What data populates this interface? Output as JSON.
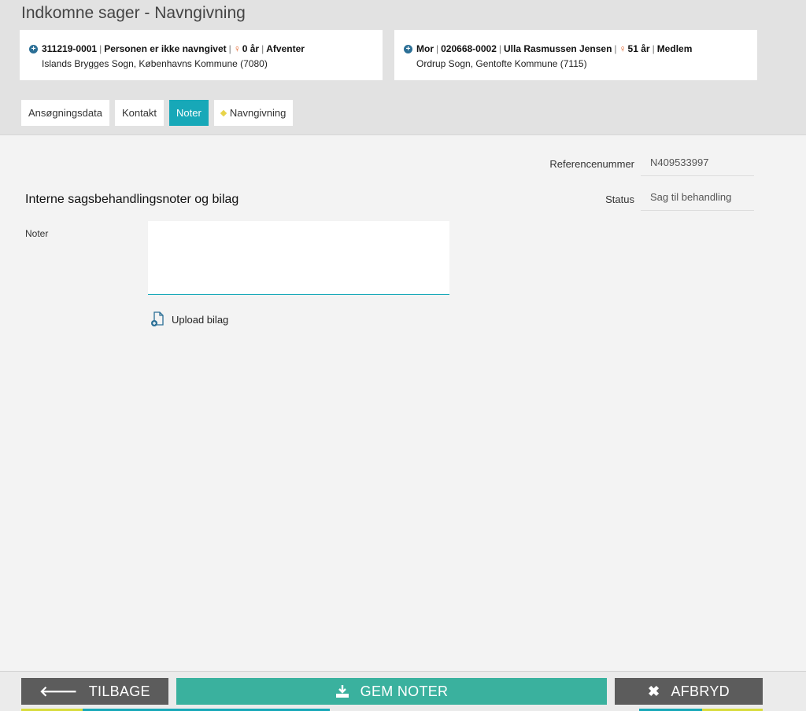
{
  "page": {
    "title": "Indkomne sager - Navngivning"
  },
  "cards": [
    {
      "cpr_prefix": "311219-",
      "cpr_suffix": "0001",
      "name": "Personen er ikke navngivet",
      "age": "0 år",
      "status": "Afventer",
      "address": "Islands Brygges Sogn, Københavns Kommune (7080)"
    },
    {
      "role": "Mor",
      "cpr_prefix": "020668-",
      "cpr_suffix": "0002",
      "name": "Ulla Rasmussen Jensen",
      "age": "51 år",
      "status": "Medlem",
      "address": "Ordrup Sogn, Gentofte Kommune (7115)"
    }
  ],
  "tabs": [
    {
      "label": "Ansøgningsdata"
    },
    {
      "label": "Kontakt"
    },
    {
      "label": "Noter"
    },
    {
      "label": "Navngivning"
    }
  ],
  "meta": {
    "ref_label": "Referencenummer",
    "ref_value": "N409533997",
    "status_label": "Status",
    "status_value": "Sag til behandling"
  },
  "section": {
    "title": "Interne sagsbehandlingsnoter og bilag",
    "notes_label": "Noter",
    "notes_value": "",
    "upload_label": "Upload bilag"
  },
  "footer": {
    "back_label": "TILBAGE",
    "save_label": "GEM NOTER",
    "cancel_label": "AFBRYD"
  },
  "colors": {
    "accent": "#17a8b8",
    "save_button": "#3ab19e",
    "dark_button": "#5c5c5c",
    "icon_blue": "#2b6f96",
    "person_orange": "#e05a1e",
    "stripe_yellow": "#d8dc3c"
  },
  "icons": {
    "card_expand": "plus-circle-icon",
    "person": "female-person-icon",
    "tab_marker": "diamond-icon",
    "upload": "file-add-icon",
    "back": "arrow-left-icon",
    "save": "download-icon",
    "cancel": "close-icon"
  }
}
